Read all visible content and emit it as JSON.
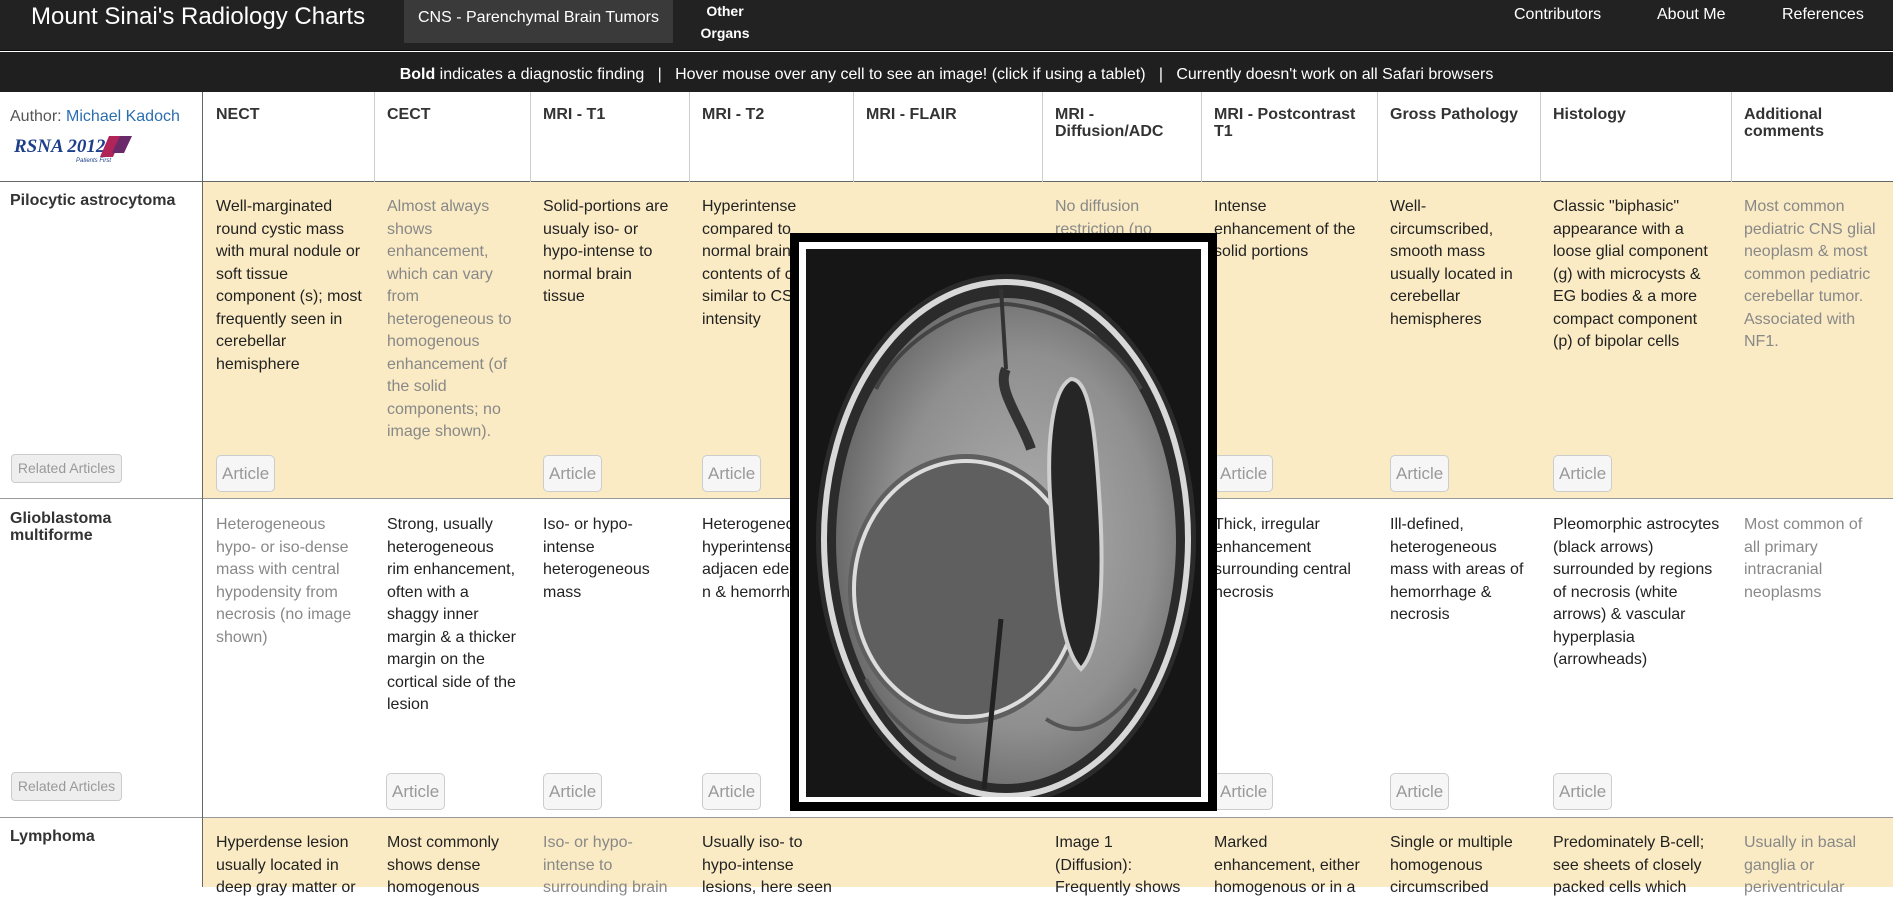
{
  "nav": {
    "brand": "Mount Sinai's Radiology Charts",
    "active_tab": "CNS - Parenchymal Brain Tumors",
    "other_line1": "Other",
    "other_line2": "Organs",
    "contributors": "Contributors",
    "about": "About Me",
    "references": "References"
  },
  "infobar": {
    "bold": "Bold",
    "part1": " indicates a diagnostic finding   |   Hover mouse over any cell to see an image! (click if using a tablet)   |   Currently doesn't work on all Safari browsers"
  },
  "author": {
    "prefix": "Author: ",
    "name": "Michael Kadoch",
    "logo_text": "RSNA 2012",
    "logo_sub": "Patients First"
  },
  "headers": [
    "NECT",
    "CECT",
    "MRI - T1",
    "MRI - T2",
    "MRI - FLAIR",
    "MRI - Diffusion/ADC",
    "MRI - Postcontrast T1",
    "Gross Pathology",
    "Histology",
    "Additional comments"
  ],
  "rows": [
    {
      "label": "Pilocytic astrocytoma",
      "related": "Related Articles",
      "cells": [
        "Well-marginated round cystic mass with mural nodule or soft tissue component (s); most frequently seen in cerebellar hemisphere",
        "Almost always shows enhancement, which can vary from heterogeneous to homogenous enhancement (of the solid components; no image shown).",
        "Solid-portions are usualy iso- or hypo-intense to normal brain tissue",
        "Hyperintense compared to normal brain; contents of c similar to CS intensity",
        "",
        "No diffusion restriction (no",
        "Intense enhancement of the solid portions",
        "Well-circumscribed, smooth mass usually located in cerebellar hemispheres",
        "Classic \"biphasic\" appearance with a loose glial component (g) with microcysts & EG bodies & a more compact component (p) of bipolar cells",
        "Most common pediatric CNS glial neoplasm & most common pediatric cerebellar tumor. Associated with NF1."
      ]
    },
    {
      "label": "Glioblastoma multiforme",
      "related": "Related Articles",
      "cells": [
        "Heterogeneous hypo- or iso-dense mass with central hypodensity from necrosis (no image shown)",
        "Strong, usually heterogeneous rim enhancement, often with a shaggy inner margin & a thicker margin on the cortical side of the lesion",
        "Iso- or hypo-intense heterogeneous mass",
        "Heterogenec hyperintense with adjacen edema +/- n & hemorrhag",
        "",
        "",
        "Thick, irregular enhancement surrounding central necrosis",
        "Ill-defined, heterogeneous mass with areas of hemorrhage & necrosis",
        "Pleomorphic astrocytes (black arrows) surrounded by regions of necrosis (white arrows) & vascular hyperplasia (arrowheads)",
        "Most common of all primary intracranial neoplasms"
      ]
    },
    {
      "label": "Lymphoma",
      "cells": [
        "Hyperdense lesion usually located in deep gray matter or",
        "Most commonly shows dense homogenous",
        "Iso- or hypo-intense to surrounding brain",
        "Usually iso- to hypo-intense lesions, here seen",
        "",
        "Image 1 (Diffusion): Frequently shows",
        "Marked enhancement, either homogenous or in a",
        "Single or multiple homogenous circumscribed",
        "Predominately B-cell; see sheets of closely packed cells which",
        "Usually in basal ganglia or periventricular"
      ]
    }
  ],
  "article_label": "Article"
}
